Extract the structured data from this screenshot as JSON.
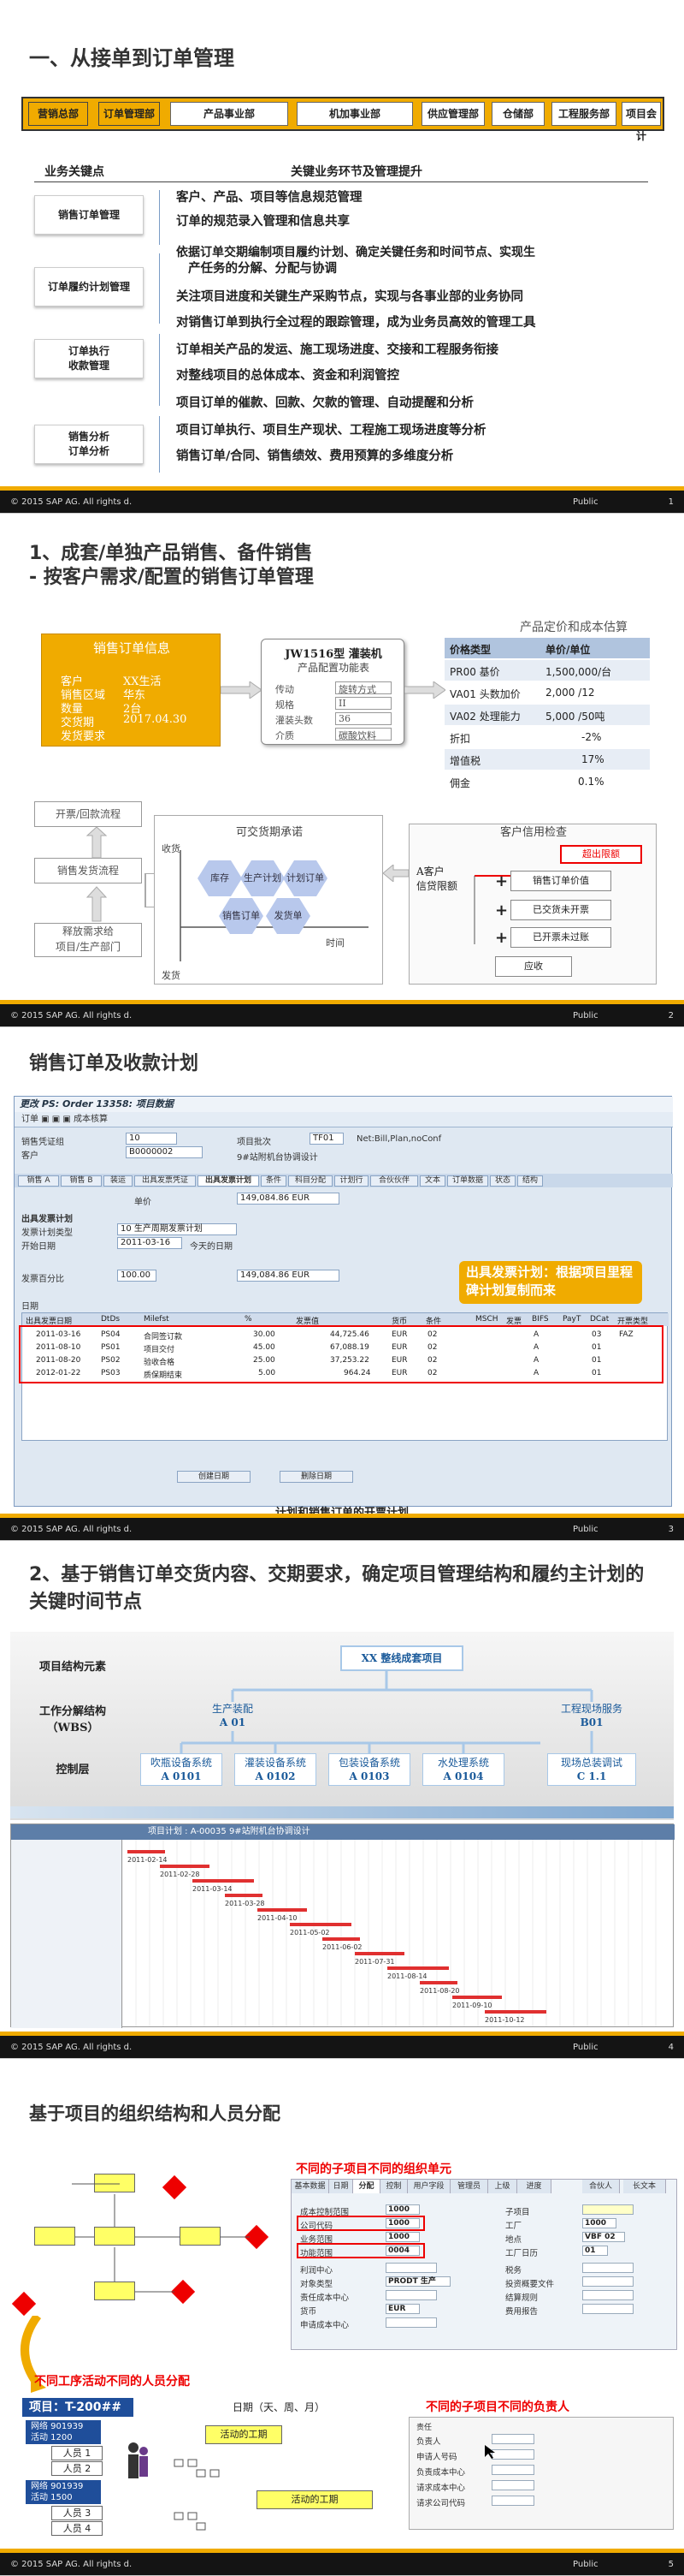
{
  "footer": {
    "copyright": "© 2015 SAP AG. All rights d.",
    "public": "Public"
  },
  "slide1": {
    "title": "一、从接单到订单管理",
    "process": [
      "营销总部",
      "订单管理部",
      "产品事业部",
      "机加事业部",
      "供应管理部",
      "仓储部",
      "工程服务部",
      "项目会计"
    ],
    "col_left": "业务关键点",
    "col_right": "关键业务环节及管理提升",
    "left_buttons": [
      "销售订单管理",
      "订单履约计划管理",
      "订单执行\n收款管理",
      "销售分析\n订单分析"
    ],
    "items": [
      "客户、产品、项目等信息规范管理",
      "订单的规范录入管理和信息共享",
      "依据订单交期编制项目履约计划、确定关键任务和时间节点、实现生",
      "产任务的分解、分配与协调",
      "关注项目进度和关键生产采购节点，实现与各事业部的业务协同",
      "对销售订单到执行全过程的跟踪管理，成为业务员高效的管理工具",
      "订单相关产品的发运、施工现场进度、交接和工程服务衔接",
      "对整线项目的总体成本、资金和利润管控",
      "项目订单的催款、回款、欠款的管理、自动提醒和分析",
      "项目订单执行、项目生产现状、工程施工现场进度等分析",
      "销售订单/合同、销售绩效、费用预算的多维度分析"
    ],
    "page": "1"
  },
  "slide2": {
    "title1": "1、成套/单独产品销售、备件销售",
    "title2": "- 按客户需求/配置的销售订单管理",
    "order_card": {
      "head": "销售订单信息",
      "rows": [
        {
          "k": "客户",
          "v": "XX生活"
        },
        {
          "k": "销售区域",
          "v": "华东"
        },
        {
          "k": "数量",
          "v": "2台"
        },
        {
          "k": "交货期",
          "v": "2017.04.30"
        },
        {
          "k": "发货要求",
          "v": ""
        }
      ]
    },
    "jw_card": {
      "title": "JW1516型 灌装机",
      "subtitle": "产品配置功能表",
      "rows": [
        {
          "k": "传动",
          "v": "旋转方式"
        },
        {
          "k": "规格",
          "v": "II"
        },
        {
          "k": "灌装头数",
          "v": "36"
        },
        {
          "k": "介质",
          "v": "碳酸饮料"
        }
      ]
    },
    "price": {
      "title": "产品定价和成本估算",
      "header": [
        "价格类型",
        "单价/单位"
      ],
      "rows": [
        [
          "PR00 基价",
          "1,500,000/台"
        ],
        [
          "VA01 头数加价",
          "2,000 /12"
        ],
        [
          "VA02 处理能力",
          "5,000 /50吨"
        ],
        [
          "折扣",
          "-2%"
        ],
        [
          "增值税",
          "17%"
        ],
        [
          "佣金",
          "0.1%"
        ]
      ]
    },
    "left_flow": [
      "开票/回款流程",
      "销售发货流程",
      "释放需求给\n项目/生产部门"
    ],
    "delivery": {
      "title": "可交货期承诺",
      "y_top": "收货",
      "y_bottom": "发货",
      "x": "时间",
      "hex": [
        "库存",
        "生产计划",
        "计划订单",
        "销售订单",
        "发货单"
      ]
    },
    "credit": {
      "title": "客户信用检查",
      "client": "A客户\n信贷限额",
      "over": "超出限额",
      "items": [
        "销售订单价值",
        "已交货未开票",
        "已开票未过账",
        "应收"
      ]
    },
    "page": "2"
  },
  "slide3": {
    "title": "销售订单及收款计划",
    "window_title": "更改 PS: Order 13358: 项目数据",
    "toolbar": "订单 ▣ ▣  ▣ 成本核算",
    "fields": {
      "order_type_lbl": "销售凭证组",
      "order_type": "10",
      "net_lbl": "Net:Bill,Plan,noConf",
      "customer_lbl": "客户",
      "customer": "B0000002",
      "proj_lbl": "项目批次",
      "proj": "TF01",
      "item_lbl": "9#站附机台协调设计"
    },
    "tabs": [
      "销售 A",
      "销售 B",
      "装运",
      "出具发票凭证",
      "出具发票计划",
      "条件",
      "科目分配",
      "计划行",
      "合伙伙伴",
      "文本",
      "订单数据",
      "状态",
      "结构"
    ],
    "plan_lbl": "出具发票计划",
    "plan_value_lbl": "单价",
    "plan_value": "149,084.86  EUR",
    "plan_type_lbl": "发票计划类型",
    "plan_type": "10  生产周期发票计划",
    "start_lbl": "开始日期",
    "start": "2011-03-16",
    "end_lbl": "今天的日期",
    "total_lbl": "发票百分比",
    "total": "100.00",
    "total_val": "149,084.86  EUR",
    "callout": "出具发票计划：根据项目里程碑计划复制而来",
    "grid_lbl": "日期",
    "grid_header": [
      "出具发票日期",
      "DtDs",
      "Milefst",
      "%",
      "发票值",
      "货币",
      "条件",
      "MSCH",
      "发票",
      "BIFS",
      "PayT",
      "DCat",
      "开票类型"
    ],
    "grid_rows": [
      [
        "2011-03-16",
        "PS04",
        "合同签订款",
        "30.00",
        "44,725.46",
        "EUR",
        "02",
        "A",
        "03",
        "FAZ"
      ],
      [
        "2011-08-10",
        "PS01",
        "项目交付",
        "45.00",
        "67,088.19",
        "EUR",
        "02",
        "A",
        "01",
        ""
      ],
      [
        "2011-08-20",
        "PS02",
        "验收合格",
        "25.00",
        "37,253.22",
        "EUR",
        "02",
        "A",
        "01",
        ""
      ],
      [
        "2012-01-22",
        "PS03",
        "质保期结束",
        "5.00",
        "964.24",
        "EUR",
        "02",
        "A",
        "01",
        ""
      ]
    ],
    "buttons": [
      "创建日期",
      "删除日期"
    ],
    "caption": "计划和销售订单的开票计划",
    "page": "3"
  },
  "slide4": {
    "title": "2、基于销售订单交货内容、交期要求，确定项目管理结构和履约主计划的关键时间节点",
    "labels": [
      "项目结构元素",
      "工作分解结构\n（WBS）",
      "控制层"
    ],
    "top": "XX 整线成套项目",
    "lvl1": [
      {
        "name": "生产装配",
        "code": "A 01"
      },
      {
        "name": "工程现场服务",
        "code": "B01"
      }
    ],
    "lvl2": [
      {
        "name": "吹瓶设备系统",
        "code": "A 0101"
      },
      {
        "name": "灌装设备系统",
        "code": "A 0102"
      },
      {
        "name": "包装设备系统",
        "code": "A 0103"
      },
      {
        "name": "水处理系统",
        "code": "A 0104"
      },
      {
        "name": "现场总装调试",
        "code": "C 1.1"
      }
    ],
    "gantt_title": "项目计划 : A-00035  9#站附机台协调设计",
    "gantt_dates": [
      "2011-02-14",
      "2011-02-28",
      "2011-03-14",
      "2011-03-28",
      "2011-04-10",
      "2011-05-02",
      "2011-06-02",
      "2011-07-31",
      "2011-08-14",
      "2011-08-20",
      "2011-09-10",
      "2011-10-12"
    ],
    "page": "4"
  },
  "slide5": {
    "title": "基于项目的组织结构和人员分配",
    "red1": "不同的子项目不同的组织单元",
    "red2": "不同工序活动不同的人员分配",
    "red3": "不同的子项目不同的负责人",
    "org_tabs": [
      "基本数据",
      "日期",
      "分配",
      "控制",
      "用户字段",
      "管理员",
      "上级",
      "进度",
      "合伙人",
      "长文本"
    ],
    "org_fields": [
      {
        "k": "成本控制范围",
        "v": "1000"
      },
      {
        "k": "公司代码",
        "v": "1000"
      },
      {
        "k": "业务范围",
        "v": "1000"
      },
      {
        "k": "功能范围",
        "v": "0004"
      },
      {
        "k": "利润中心",
        "v": ""
      },
      {
        "k": "对象类型",
        "v": "PRODT 生产"
      },
      {
        "k": "责任成本中心",
        "v": ""
      },
      {
        "k": "货币",
        "v": "EUR"
      },
      {
        "k": "申请成本中心",
        "v": ""
      }
    ],
    "org_fields_r": [
      {
        "k": "子项目",
        "v": ""
      },
      {
        "k": "工厂",
        "v": "1000"
      },
      {
        "k": "地点",
        "v": "VBF 02"
      },
      {
        "k": "工厂日历",
        "v": "01"
      },
      {
        "k": "税务",
        "v": ""
      },
      {
        "k": "投资概要文件",
        "v": ""
      },
      {
        "k": "结算规则",
        "v": ""
      },
      {
        "k": "费用报告",
        "v": ""
      }
    ],
    "project": "项目：T-200##",
    "groups": [
      {
        "net": "网络 901939",
        "act": "活动 1200",
        "p": [
          "人员 1",
          "人员 2"
        ]
      },
      {
        "net": "网络 901939",
        "act": "活动 1500",
        "p": [
          "人员 3",
          "人员 4"
        ]
      }
    ],
    "timeline": "日期（天、周、月）",
    "activity": "活动的工期",
    "resp_rows": [
      "负责人",
      "申请人号码",
      "负责成本中心",
      "请求成本中心",
      "请求公司代码"
    ],
    "page": "5"
  }
}
